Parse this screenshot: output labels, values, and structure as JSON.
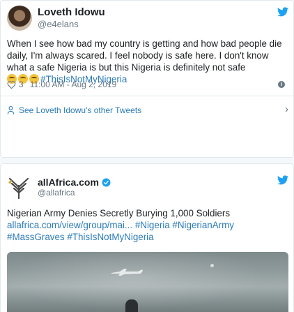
{
  "tweet1": {
    "display_name": "Loveth Idowu",
    "handle": "@e4elans",
    "text": "When I see how bad my country is getting and how bad people die daily, I'm always scared. I feel nobody is safe here. I don't know what a safe Nigeria is but this Nigeria is definitely not safe",
    "hashtag": "#ThisIsNotMyNigeria",
    "emoji_count": 3,
    "likes": "3",
    "timestamp": "11:00 AM - Aug 2, 2019",
    "other_tweets_label": "See Loveth Idowu's other Tweets"
  },
  "tweet2": {
    "display_name": "allAfrica.com",
    "handle": "@allafrica",
    "headline": "Nigerian Army Denies Secretly Burying 1,000 Soldiers",
    "link_text": "allafrica.com/view/group/mai...",
    "hashtags_line1": "#Nigeria #NigerianArmy",
    "hashtags_line2": "#MassGraves #ThisIsNotMyNigeria"
  },
  "colors": {
    "accent": "#1da1f2",
    "link": "#2b7bb9",
    "muted": "#697882",
    "text": "#1c2022",
    "border": "#e1e8ed"
  },
  "icons": {
    "logo": "twitter-bird-icon",
    "like": "heart-icon",
    "info": "info-icon",
    "profile": "person-icon",
    "expand": "chevron-right-icon",
    "verified": "verified-badge-icon",
    "brand": "allafrica-logo-icon"
  }
}
